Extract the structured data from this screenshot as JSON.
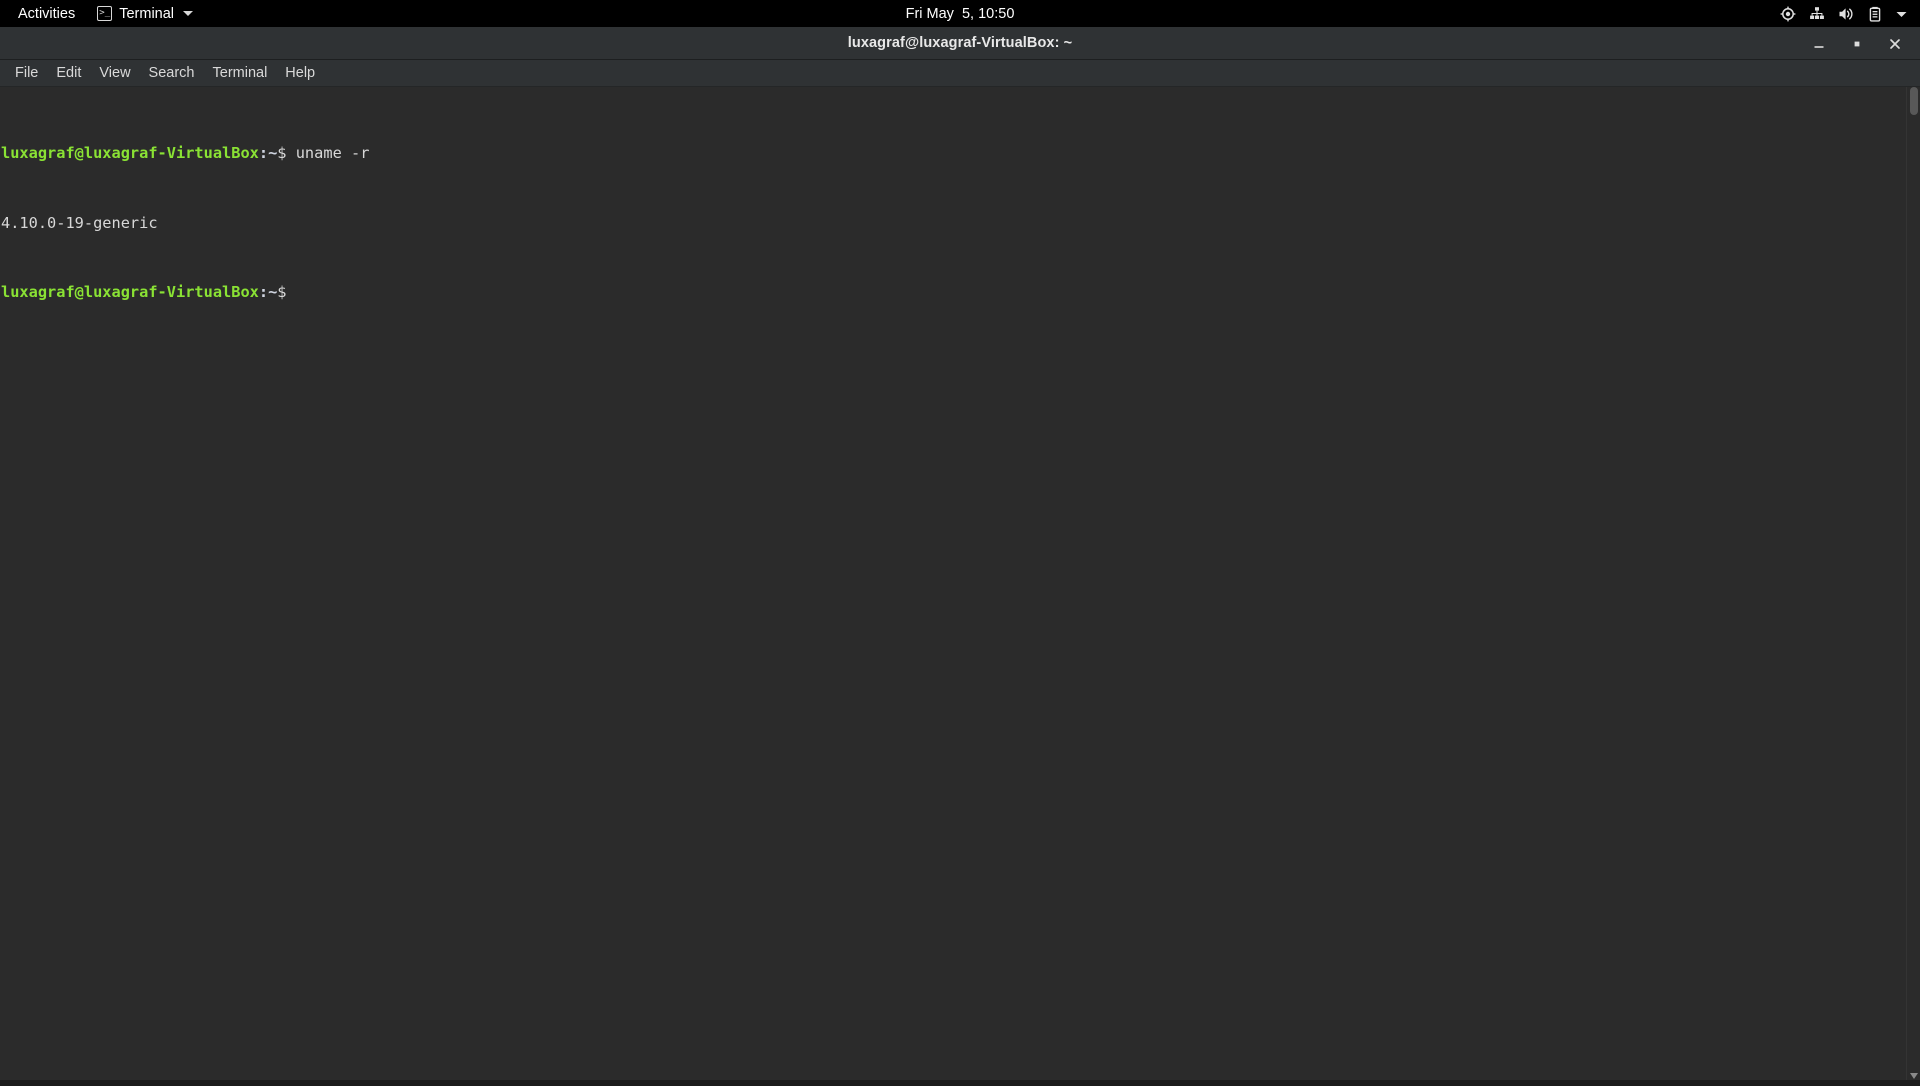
{
  "top_bar": {
    "activities_label": "Activities",
    "app_menu_label": "Terminal",
    "app_icon": "terminal-icon",
    "app_icon_glyph": ">_",
    "clock": "Fri May  5, 10:50",
    "tray_icons": [
      {
        "name": "location-services-icon",
        "title": "Location Services"
      },
      {
        "name": "wired-network-icon",
        "title": "Wired Network"
      },
      {
        "name": "volume-icon",
        "title": "Volume"
      },
      {
        "name": "battery-icon",
        "title": "Battery"
      },
      {
        "name": "chevron-down-icon",
        "title": "System Menu"
      }
    ]
  },
  "window": {
    "title": "luxagraf@luxagraf-VirtualBox: ~",
    "controls": {
      "minimize_label": "–",
      "maximize_label": "□",
      "close_label": "×"
    }
  },
  "menubar": {
    "items": [
      {
        "label": "File",
        "name": "menu-file"
      },
      {
        "label": "Edit",
        "name": "menu-edit"
      },
      {
        "label": "View",
        "name": "menu-view"
      },
      {
        "label": "Search",
        "name": "menu-search"
      },
      {
        "label": "Terminal",
        "name": "menu-terminal"
      },
      {
        "label": "Help",
        "name": "menu-help"
      }
    ]
  },
  "terminal": {
    "prompt_user": "luxagraf@luxagraf-VirtualBox",
    "prompt_path": ":~",
    "prompt_dollar": "$",
    "lines": [
      {
        "type": "prompt",
        "command": " uname -r"
      },
      {
        "type": "output",
        "text": "4.10.0-19-generic"
      },
      {
        "type": "prompt",
        "command": ""
      }
    ],
    "command_line_1": " uname -r",
    "output_line_1": "4.10.0-19-generic",
    "command_line_2": ""
  },
  "colors": {
    "top_bar_bg": "#000000",
    "titlebar_bg": "#2f3234",
    "terminal_bg": "#2b2b2b",
    "prompt_green": "#8ae234",
    "prompt_blue": "#cfd4e0",
    "text_grey": "#d8d8d8"
  }
}
